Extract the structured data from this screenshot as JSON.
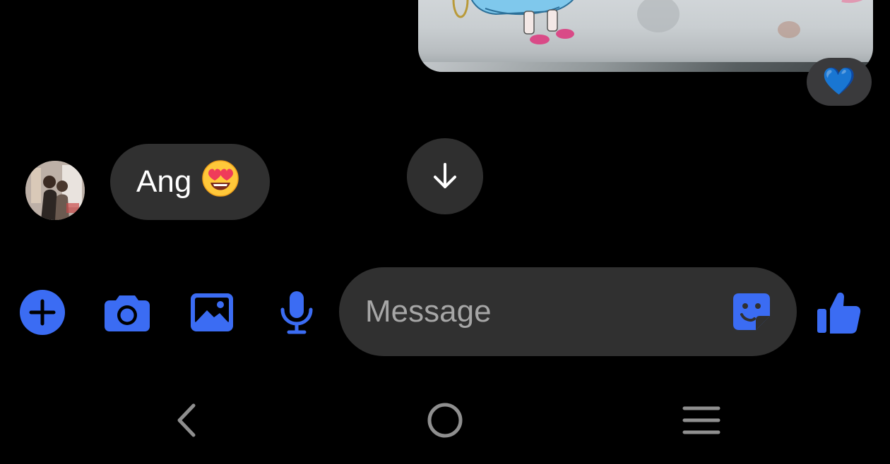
{
  "conversation": {
    "sent_image": {
      "reaction_emoji": "💙",
      "icon": "photo-thumbnail"
    },
    "received": {
      "text": "Ang",
      "emoji": "😍"
    },
    "scroll_down_icon": "arrow-down-icon"
  },
  "composer": {
    "placeholder": "Message",
    "icons": {
      "more": "plus-icon",
      "camera": "camera-icon",
      "gallery": "image-icon",
      "voice": "microphone-icon",
      "sticker": "sticker-icon",
      "like": "thumbs-up-icon"
    }
  },
  "system_nav": {
    "back": "back-icon",
    "home": "home-icon",
    "recents": "recents-icon"
  },
  "colors": {
    "background": "#000000",
    "bubble": "#303030",
    "accent": "#3b6cf3",
    "placeholder_text": "#a6a6a6",
    "nav_icons": "#8f8f8f"
  }
}
